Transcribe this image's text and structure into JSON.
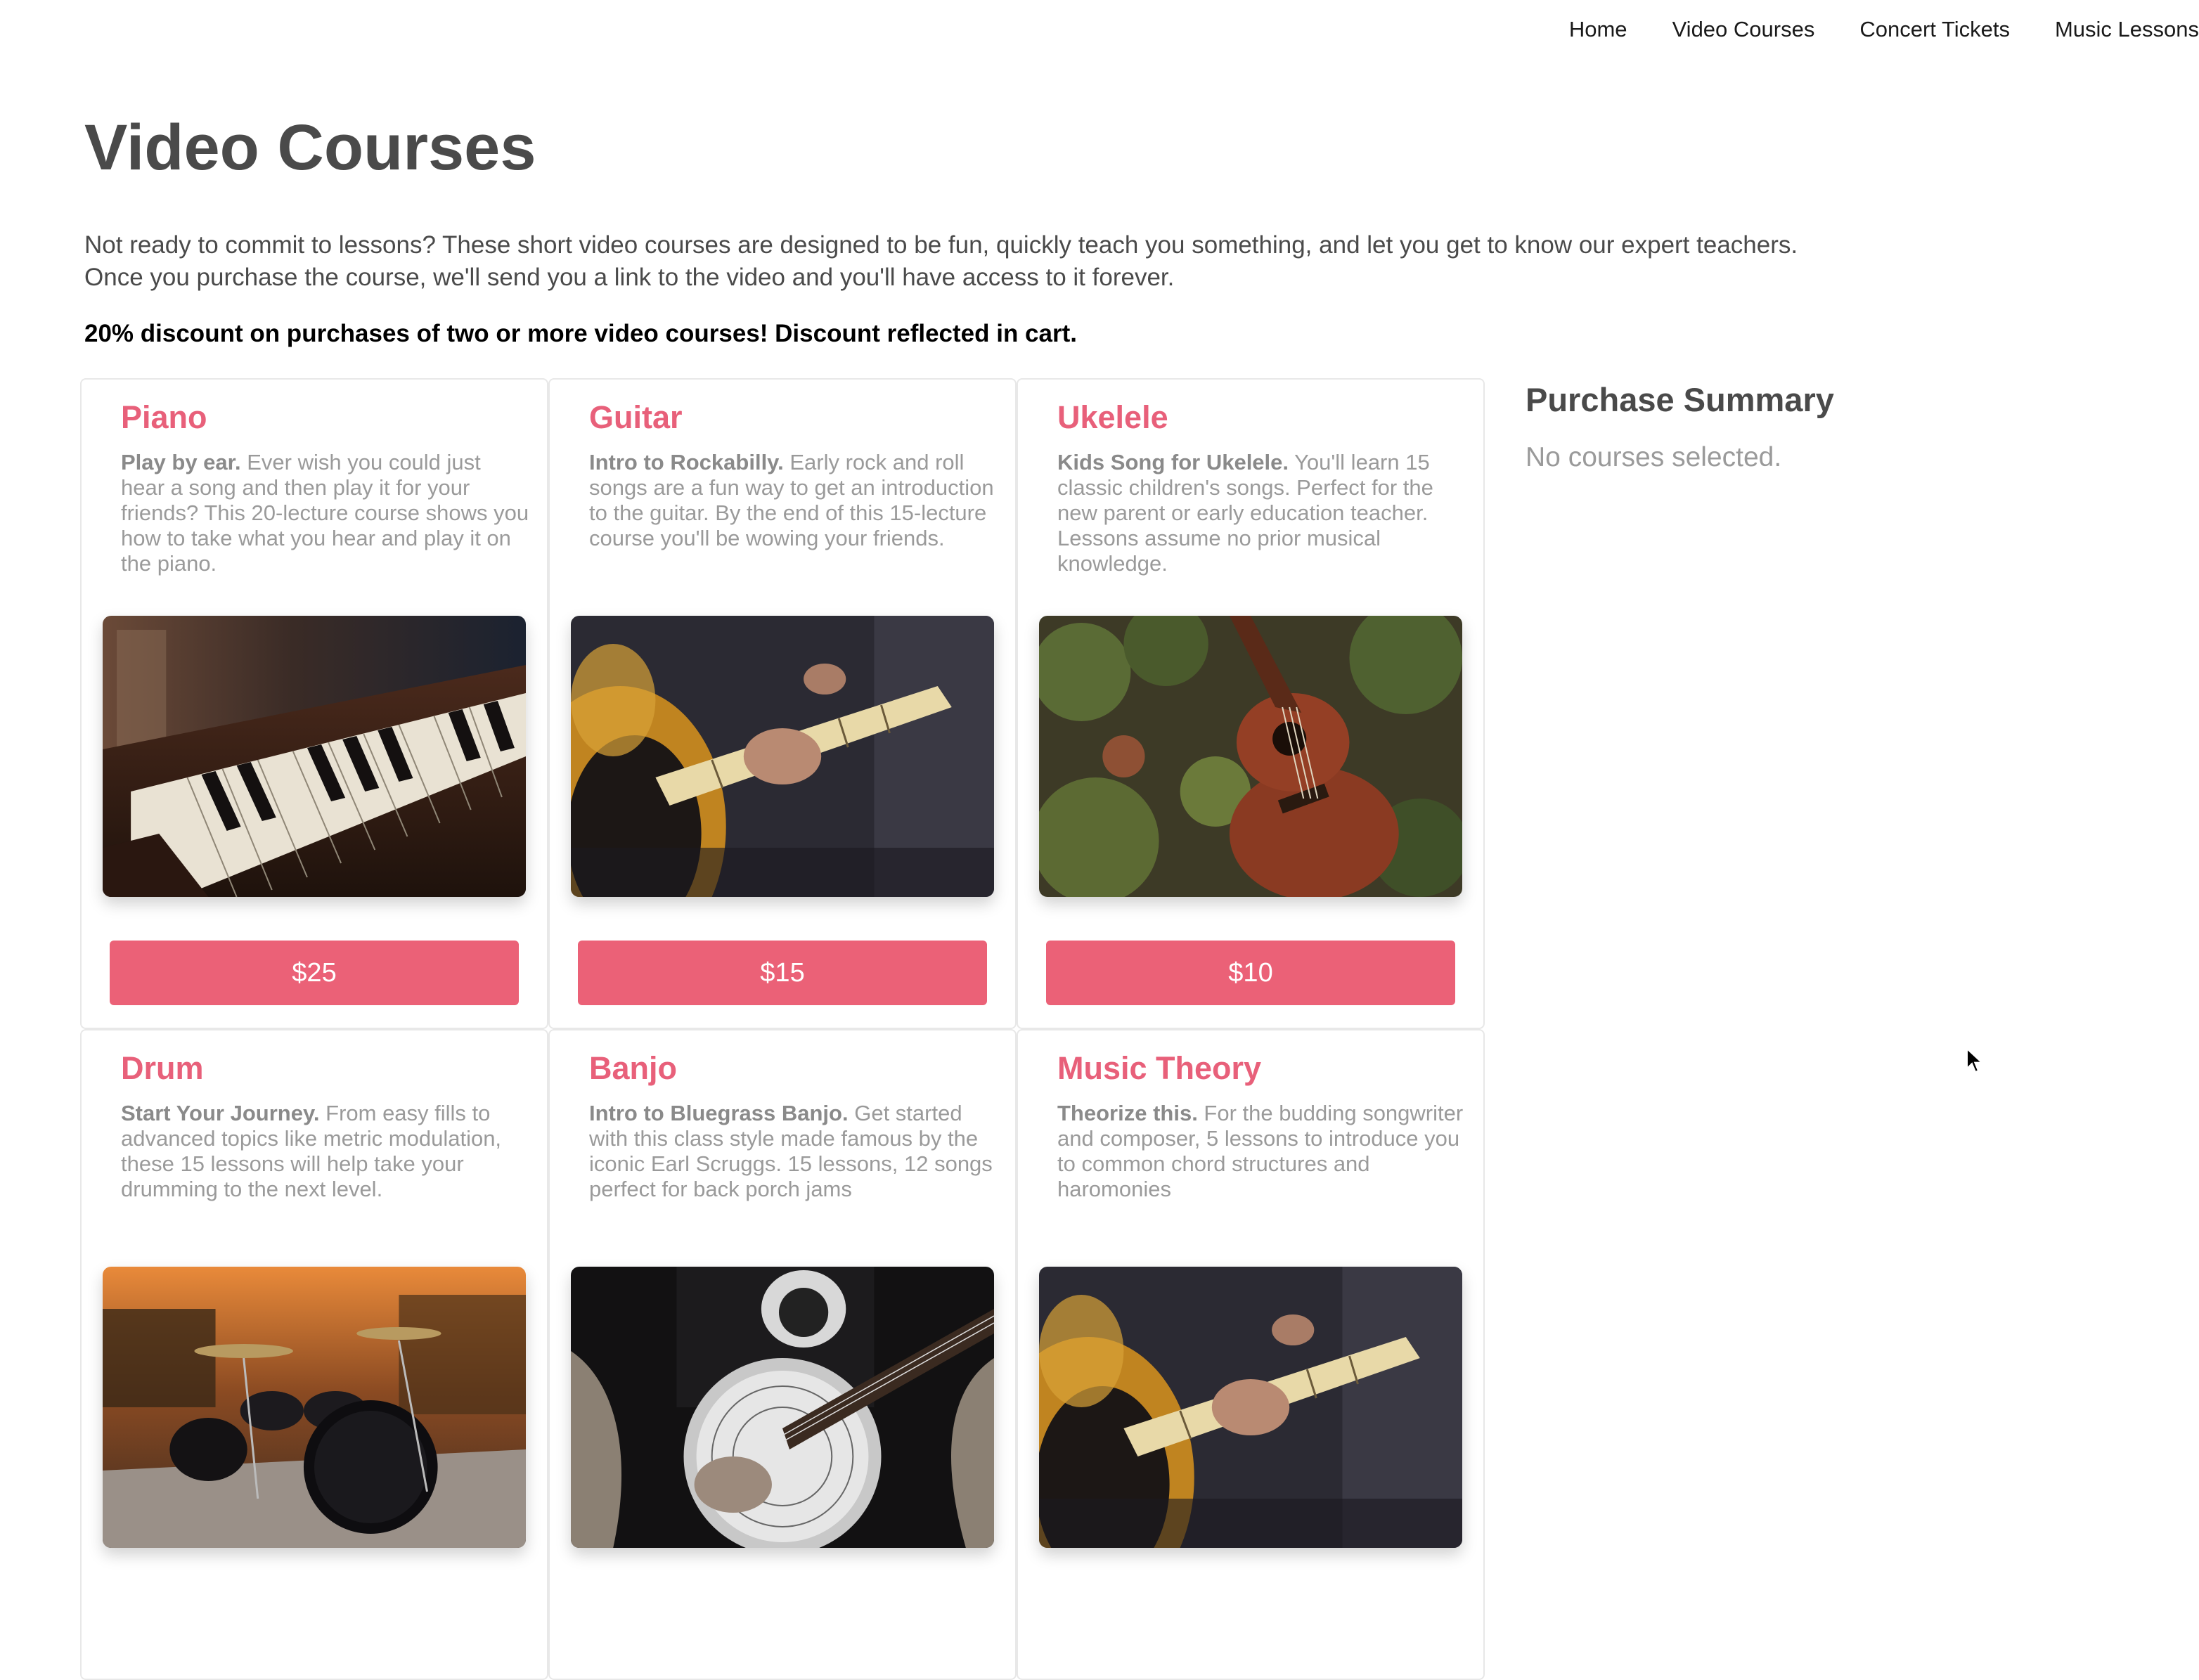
{
  "nav": {
    "items": [
      "Home",
      "Video Courses",
      "Concert Tickets",
      "Music Lessons"
    ]
  },
  "page": {
    "title": "Video Courses",
    "intro": "Not ready to commit to lessons? These short video courses are designed to be fun, quickly teach you something, and let you get to know our expert teachers. Once you purchase the course, we'll send you a link to the video and you'll have access to it forever.",
    "discount": "20% discount on purchases of two or more video courses! Discount reflected in cart."
  },
  "courses": [
    {
      "title": "Piano",
      "lead": "Play by ear.",
      "desc": " Ever wish you could just hear a song and then play it for your friends? This 20-lecture course shows you how to take what you hear and play it on the piano.",
      "price": "$25",
      "image": "piano-photo"
    },
    {
      "title": "Guitar",
      "lead": "Intro to Rockabilly.",
      "desc": " Early rock and roll songs are a fun way to get an introduction to the guitar. By the end of this 15-lecture course you'll be wowing your friends.",
      "price": "$15",
      "image": "guitar-photo"
    },
    {
      "title": "Ukelele",
      "lead": "Kids Song for Ukelele.",
      "desc": " You'll learn 15 classic children's songs. Perfect for the new parent or early education teacher. Lessons assume no prior musical knowledge.",
      "price": "$10",
      "image": "ukulele-photo"
    },
    {
      "title": "Drum",
      "lead": "Start Your Journey.",
      "desc": " From easy fills to advanced topics like metric modulation, these 15 lessons will help take your drumming to the next level.",
      "price": "",
      "image": "drum-kit-photo"
    },
    {
      "title": "Banjo",
      "lead": "Intro to Bluegrass Banjo.",
      "desc": " Get started with this class style made famous by the iconic Earl Scruggs. 15 lessons, 12 songs perfect for back porch jams",
      "price": "",
      "image": "banjo-photo"
    },
    {
      "title": "Music Theory",
      "lead": "Theorize this.",
      "desc": " For the budding songwriter and composer, 5 lessons to introduce you to common chord structures and haromonies",
      "price": "",
      "image": "guitar-photo"
    }
  ],
  "summary": {
    "title": "Purchase Summary",
    "empty_text": "No courses selected."
  },
  "colors": {
    "accent": "#eb6177",
    "title_pink": "#e8607a",
    "text": "#4a4a4a",
    "muted": "#9a9a9a"
  }
}
